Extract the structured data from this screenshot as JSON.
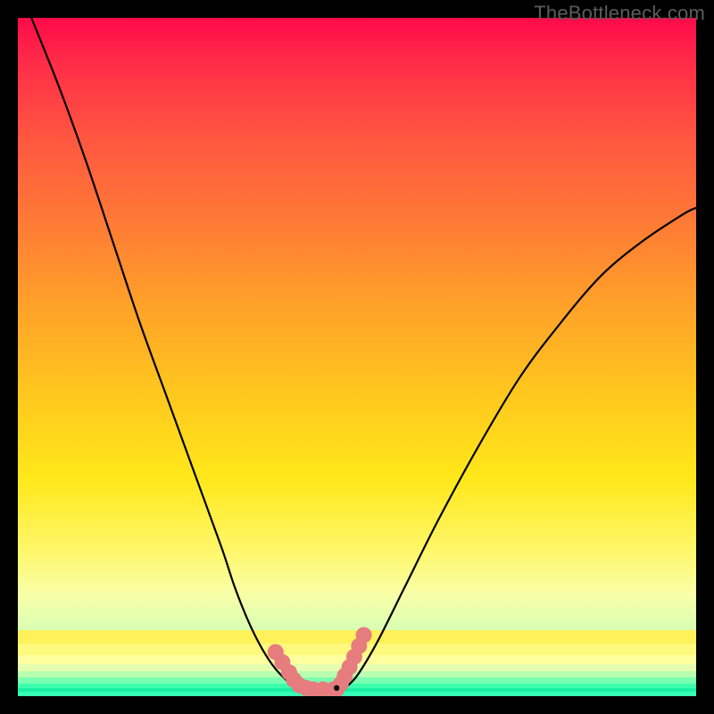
{
  "watermark": {
    "text": "TheBottleneck.com"
  },
  "chart_data": {
    "type": "line",
    "title": "",
    "xlabel": "",
    "ylabel": "",
    "xlim": [
      0,
      100
    ],
    "ylim": [
      0,
      100
    ],
    "series": [
      {
        "name": "left-curve",
        "x": [
          2,
          6,
          10,
          14,
          18,
          22,
          26,
          30,
          32,
          34,
          36,
          38,
          40,
          41.5
        ],
        "y": [
          100,
          90,
          79,
          67,
          55,
          44,
          33,
          22,
          16,
          11,
          7,
          4,
          2,
          1
        ]
      },
      {
        "name": "right-curve",
        "x": [
          48,
          50,
          53,
          57,
          62,
          68,
          74,
          80,
          86,
          92,
          98,
          100
        ],
        "y": [
          1,
          3,
          8,
          16,
          26,
          37,
          47,
          55,
          62,
          67,
          71,
          72
        ]
      },
      {
        "name": "flat-bottom",
        "x": [
          41.5,
          48
        ],
        "y": [
          1,
          1
        ]
      }
    ],
    "highlights": [
      {
        "name": "left-pink-dots",
        "x": [
          38,
          39,
          40,
          40.7,
          41.5,
          42.5,
          43.5,
          45,
          46.5
        ],
        "y": [
          6.5,
          5,
          3.5,
          2.4,
          1.6,
          1.2,
          1.0,
          1.0,
          1.0
        ]
      },
      {
        "name": "right-pink-dots",
        "x": [
          47,
          47.6,
          48.2,
          48.9,
          49.6,
          50.3,
          51
        ],
        "y": [
          1.0,
          1.8,
          3.0,
          4.3,
          5.8,
          7.4,
          9.0
        ]
      }
    ],
    "gradient_bands_bottom": [
      {
        "y": 0.0,
        "h": 0.6,
        "color": "#38ffb8"
      },
      {
        "y": 0.6,
        "h": 0.6,
        "color": "#18f0a6"
      },
      {
        "y": 1.2,
        "h": 0.7,
        "color": "#3cffad"
      },
      {
        "y": 1.9,
        "h": 0.8,
        "color": "#7bffb0"
      },
      {
        "y": 2.7,
        "h": 1.0,
        "color": "#b8ffb0"
      },
      {
        "y": 3.7,
        "h": 1.1,
        "color": "#e5ffae"
      },
      {
        "y": 4.8,
        "h": 1.3,
        "color": "#feff9f"
      },
      {
        "y": 6.1,
        "h": 1.6,
        "color": "#fff97d"
      },
      {
        "y": 7.7,
        "h": 2.0,
        "color": "#fff15a"
      }
    ]
  },
  "colors": {
    "curve": "#000000",
    "dots": "#e77c7f",
    "black_dot": "#0c0c0c",
    "frame_bg": "#000000"
  }
}
